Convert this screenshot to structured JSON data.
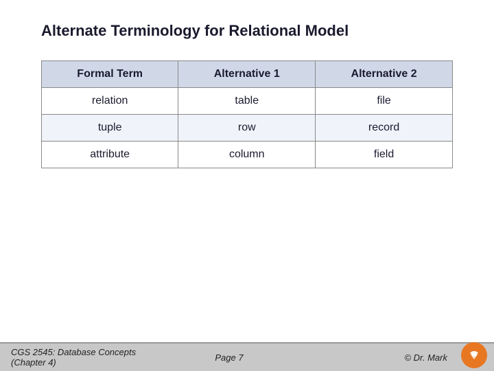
{
  "slide": {
    "title": "Alternate Terminology for Relational Model",
    "table": {
      "headers": [
        "Formal Term",
        "Alternative 1",
        "Alternative 2"
      ],
      "rows": [
        [
          "relation",
          "table",
          "file"
        ],
        [
          "tuple",
          "row",
          "record"
        ],
        [
          "attribute",
          "column",
          "field"
        ]
      ]
    }
  },
  "footer": {
    "left": "CGS 2545: Database Concepts  (Chapter 4)",
    "center": "Page 7",
    "right": "© Dr. Mark"
  }
}
